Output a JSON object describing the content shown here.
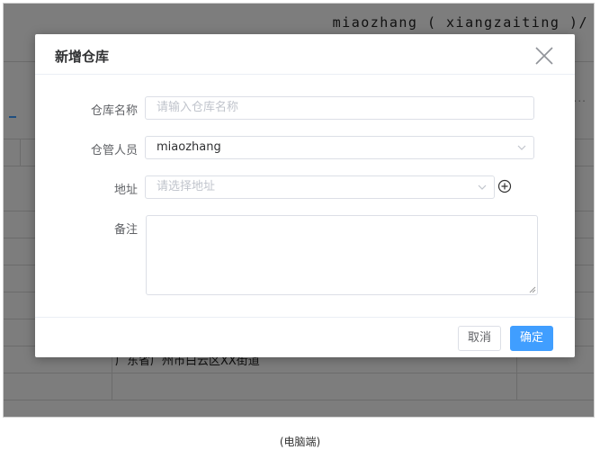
{
  "background": {
    "user_text": "miaozhang ( xiangzaiting )/",
    "row_address": "广东省广州市白云区XX街道",
    "more_dots": "..."
  },
  "dialog": {
    "title": "新增仓库",
    "fields": {
      "name": {
        "label": "仓库名称",
        "placeholder": "请输入仓库名称"
      },
      "keeper": {
        "label": "仓管人员",
        "value": "miaozhang"
      },
      "address": {
        "label": "地址",
        "placeholder": "请选择地址"
      },
      "remark": {
        "label": "备注",
        "value": ""
      }
    },
    "buttons": {
      "cancel": "取消",
      "confirm": "确定"
    }
  },
  "caption": "(电脑端)",
  "colors": {
    "primary": "#409eff",
    "mask": "rgba(0,0,0,0.5)"
  },
  "icons": {
    "close": "close-icon",
    "chevron": "chevron-down-icon",
    "add": "plus-circle-icon"
  }
}
